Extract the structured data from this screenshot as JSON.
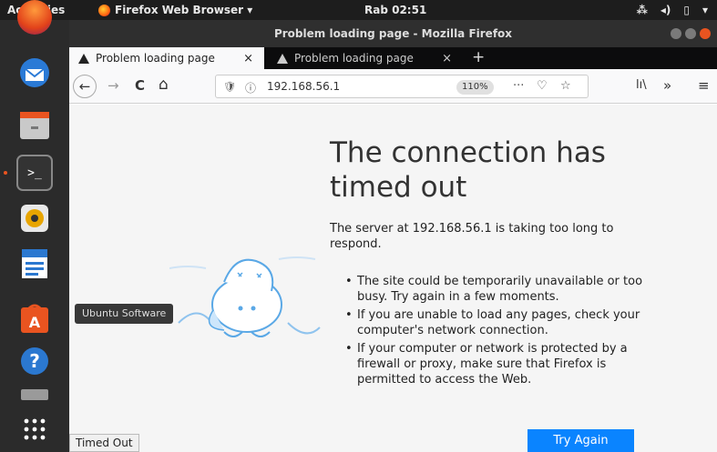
{
  "topbar": {
    "activities": "Activities",
    "app_name": "Firefox Web Browser ▾",
    "clock": "Rab 02:51",
    "tray_icons": [
      "network-icon",
      "volume-icon",
      "battery-icon",
      "menu-arrow-icon"
    ]
  },
  "dock": {
    "tooltip": "Ubuntu Software",
    "items": [
      "firefox-icon",
      "thunderbird-icon",
      "files-icon",
      "terminal-icon",
      "rhythmbox-icon",
      "writer-icon",
      "ubuntu-software-icon",
      "help-icon",
      "trash-icon",
      "show-apps-icon"
    ]
  },
  "window": {
    "title": "Problem loading page - Mozilla Firefox"
  },
  "tabs": [
    {
      "label": "Problem loading page",
      "close": "×"
    },
    {
      "label": "Problem loading page",
      "close": "×"
    }
  ],
  "newtab": "+",
  "navbar": {
    "back": "←",
    "forward": "→",
    "reload": "C",
    "home": "⌂",
    "url": "192.168.56.1",
    "zoom": "110%",
    "page_actions": "···",
    "library": "lı\\",
    "overflow": "»",
    "menu": "≡"
  },
  "page": {
    "heading": "The connection has timed out",
    "description": "The server at 192.168.56.1 is taking too long to respond.",
    "bullets": [
      "The site could be temporarily unavailable or too busy. Try again in a few moments.",
      "If you are unable to load any pages, check your computer's network connection.",
      "If your computer or network is protected by a firewall or proxy, make sure that Firefox is permitted to access the Web."
    ],
    "try_again": "Try Again",
    "status": "Timed Out"
  }
}
